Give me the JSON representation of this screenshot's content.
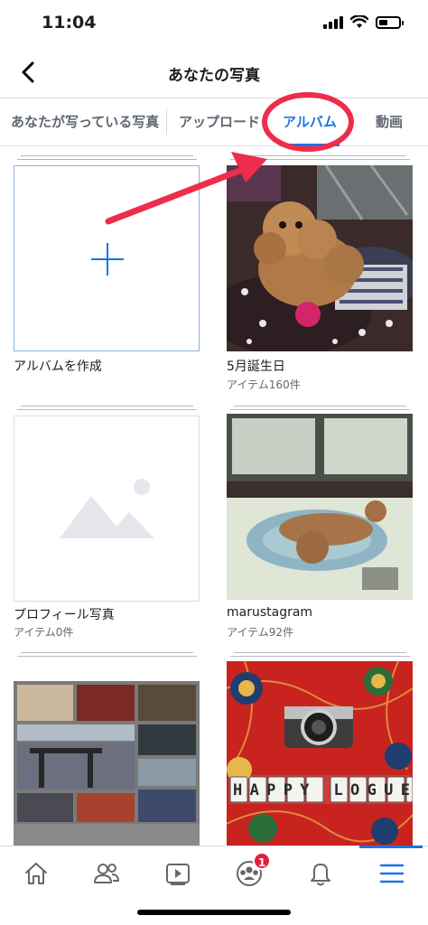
{
  "status_bar": {
    "time": "11:04"
  },
  "header": {
    "title": "あなたの写真",
    "back_icon": "chevron-left-icon"
  },
  "tabs": [
    {
      "label": "あなたが写っている写真",
      "active": false
    },
    {
      "label": "アップロード",
      "active": false
    },
    {
      "label": "アルバム",
      "active": true
    },
    {
      "label": "動画",
      "active": false
    }
  ],
  "albums": [
    {
      "name": "アルバムを作成",
      "count": "",
      "thumb": "plus-icon"
    },
    {
      "name": "5月誕生日",
      "count": "アイテム160件",
      "thumb": "photo"
    },
    {
      "name": "プロフィール写真",
      "count": "アイテム0件",
      "thumb": "image-placeholder-icon"
    },
    {
      "name": "marustagram",
      "count": "アイテム92件",
      "thumb": "photo"
    },
    {
      "name": "",
      "count": "",
      "thumb": "photo-collage"
    },
    {
      "name": "",
      "count": "",
      "thumb": "photo"
    }
  ],
  "photo_text": {
    "camera_sign": "HAPPY LOGUE"
  },
  "bottom_nav": [
    {
      "icon": "home-icon"
    },
    {
      "icon": "friends-icon"
    },
    {
      "icon": "watch-icon"
    },
    {
      "icon": "groups-icon",
      "badge": "1"
    },
    {
      "icon": "bell-icon"
    },
    {
      "icon": "menu-icon",
      "active": true
    }
  ],
  "colors": {
    "accent": "#1b74e4",
    "annotation": "#ee2d4b",
    "badge": "#e41e3f"
  }
}
